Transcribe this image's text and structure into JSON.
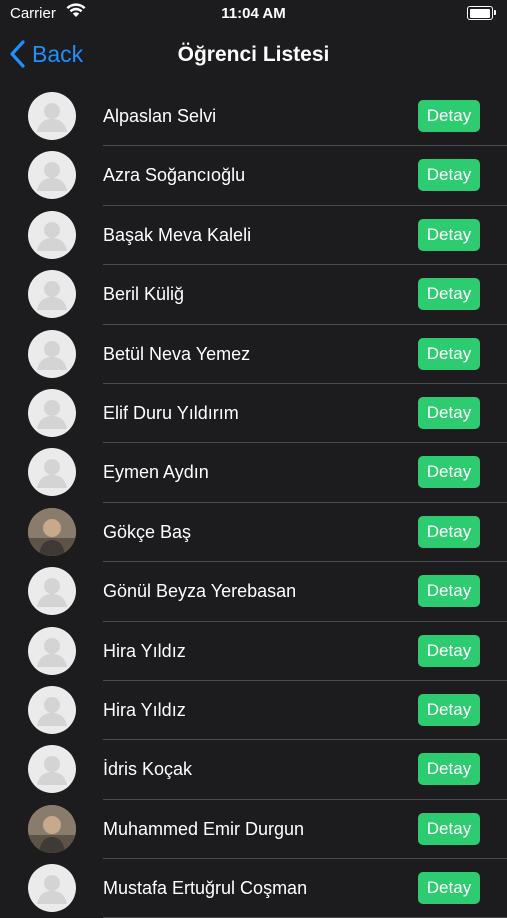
{
  "status_bar": {
    "carrier": "Carrier",
    "time": "11:04 AM",
    "battery_level": 1.0
  },
  "nav": {
    "back_label": "Back",
    "title": "Öğrenci Listesi"
  },
  "students": [
    {
      "name": "Alpaslan Selvi",
      "button": "Detay",
      "avatar": "placeholder-avatar-icon"
    },
    {
      "name": "Azra Soğancıoğlu",
      "button": "Detay",
      "avatar": "placeholder-avatar-icon"
    },
    {
      "name": "Başak Meva Kaleli",
      "button": "Detay",
      "avatar": "placeholder-avatar-icon"
    },
    {
      "name": "Beril Küliğ",
      "button": "Detay",
      "avatar": "placeholder-avatar-icon"
    },
    {
      "name": "Betül Neva Yemez",
      "button": "Detay",
      "avatar": "placeholder-avatar-icon"
    },
    {
      "name": "Elif Duru Yıldırım",
      "button": "Detay",
      "avatar": "placeholder-avatar-icon"
    },
    {
      "name": "Eymen Aydın",
      "button": "Detay",
      "avatar": "placeholder-avatar-icon"
    },
    {
      "name": "Gökçe Baş",
      "button": "Detay",
      "avatar": "photo"
    },
    {
      "name": "Gönül Beyza Yerebasan",
      "button": "Detay",
      "avatar": "placeholder-avatar-icon"
    },
    {
      "name": "Hira Yıldız",
      "button": "Detay",
      "avatar": "placeholder-avatar-icon"
    },
    {
      "name": "Hira Yıldız",
      "button": "Detay",
      "avatar": "placeholder-avatar-icon"
    },
    {
      "name": "İdris Koçak",
      "button": "Detay",
      "avatar": "placeholder-avatar-icon"
    },
    {
      "name": "Muhammed Emir Durgun",
      "button": "Detay",
      "avatar": "photo"
    },
    {
      "name": "Mustafa Ertuğrul Coşman",
      "button": "Detay",
      "avatar": "placeholder-avatar-icon"
    }
  ],
  "colors": {
    "background": "#1c1c1e",
    "accent": "#1e90ff",
    "detail_button": "#2ecc71",
    "separator": "#4a4a4c"
  }
}
